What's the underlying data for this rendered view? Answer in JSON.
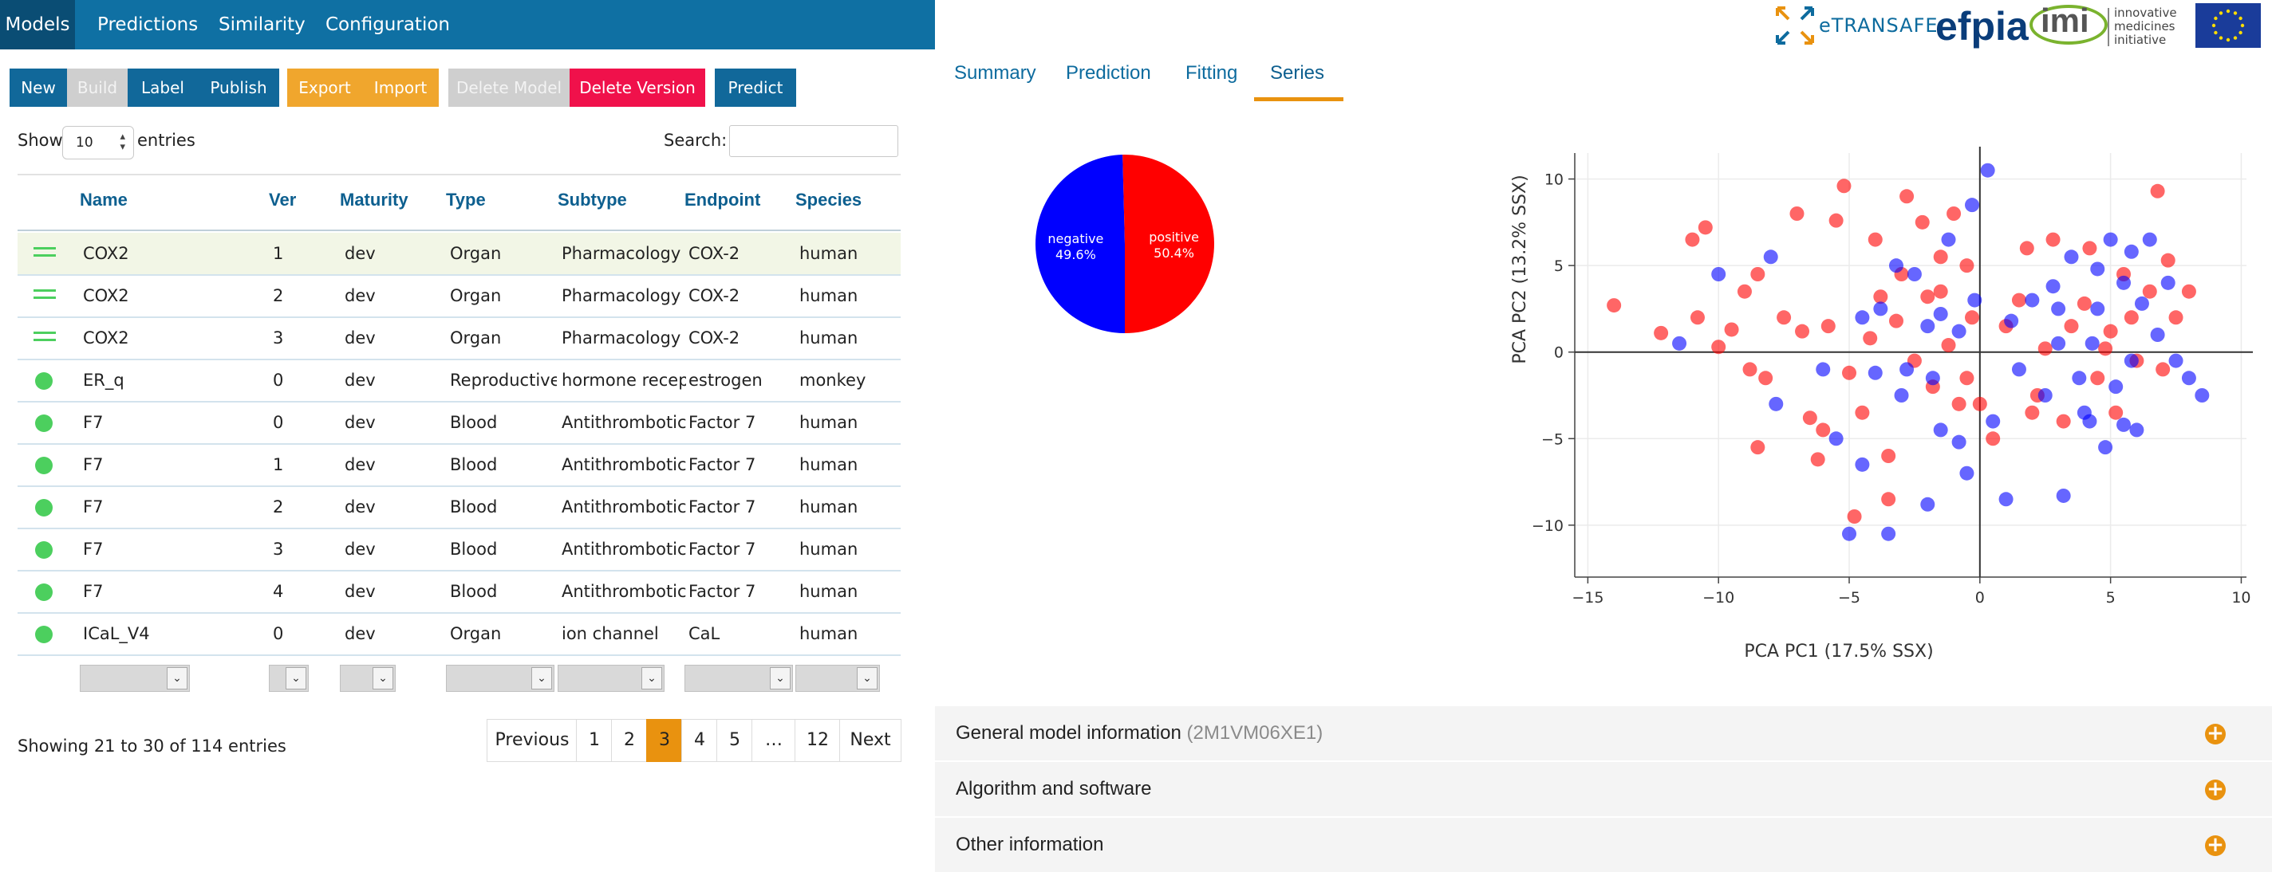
{
  "nav": {
    "tabs": [
      "Models",
      "Predictions",
      "Similarity",
      "Configuration"
    ],
    "active": "Models"
  },
  "toolbar": {
    "new": "New",
    "build": "Build",
    "label": "Label",
    "publish": "Publish",
    "export": "Export",
    "import": "Import",
    "delete_model": "Delete Model",
    "delete_version": "Delete Version",
    "predict": "Predict"
  },
  "table": {
    "show_label": "Show",
    "show_value": "10",
    "entries_label": "entries",
    "search_label": "Search:",
    "search_value": "",
    "columns": [
      "Name",
      "Ver",
      "Maturity",
      "Type",
      "Subtype",
      "Endpoint",
      "Species"
    ],
    "rows": [
      {
        "status": "draft",
        "name": "COX2",
        "ver": "1",
        "maturity": "dev",
        "type": "Organ",
        "subtype": "Pharmacology",
        "endpoint": "COX-2",
        "species": "human"
      },
      {
        "status": "draft",
        "name": "COX2",
        "ver": "2",
        "maturity": "dev",
        "type": "Organ",
        "subtype": "Pharmacology",
        "endpoint": "COX-2",
        "species": "human"
      },
      {
        "status": "draft",
        "name": "COX2",
        "ver": "3",
        "maturity": "dev",
        "type": "Organ",
        "subtype": "Pharmacology",
        "endpoint": "COX-2",
        "species": "human"
      },
      {
        "status": "published",
        "name": "ER_q",
        "ver": "0",
        "maturity": "dev",
        "type": "Reproductive",
        "subtype": "hormone recep",
        "endpoint": "estrogen",
        "species": "monkey"
      },
      {
        "status": "published",
        "name": "F7",
        "ver": "0",
        "maturity": "dev",
        "type": "Blood",
        "subtype": "Antithrombotic",
        "endpoint": "Factor 7",
        "species": "human"
      },
      {
        "status": "published",
        "name": "F7",
        "ver": "1",
        "maturity": "dev",
        "type": "Blood",
        "subtype": "Antithrombotic",
        "endpoint": "Factor 7",
        "species": "human"
      },
      {
        "status": "published",
        "name": "F7",
        "ver": "2",
        "maturity": "dev",
        "type": "Blood",
        "subtype": "Antithrombotic",
        "endpoint": "Factor 7",
        "species": "human"
      },
      {
        "status": "published",
        "name": "F7",
        "ver": "3",
        "maturity": "dev",
        "type": "Blood",
        "subtype": "Antithrombotic",
        "endpoint": "Factor 7",
        "species": "human"
      },
      {
        "status": "published",
        "name": "F7",
        "ver": "4",
        "maturity": "dev",
        "type": "Blood",
        "subtype": "Antithrombotic",
        "endpoint": "Factor 7",
        "species": "human"
      },
      {
        "status": "published",
        "name": "ICaL_V4",
        "ver": "0",
        "maturity": "dev",
        "type": "Organ",
        "subtype": "ion channel",
        "endpoint": "CaL",
        "species": "human"
      }
    ],
    "info": "Showing 21 to 30 of 114 entries",
    "pagination": {
      "prev": "Previous",
      "pages": [
        "1",
        "2",
        "3",
        "4",
        "5",
        "…",
        "12"
      ],
      "current": "3",
      "next": "Next"
    }
  },
  "detail": {
    "tabs": [
      "Summary",
      "Prediction",
      "Fitting",
      "Series"
    ],
    "active_tab": "Series",
    "accordion": [
      {
        "title": "General model information",
        "subtitle": "(2M1VM06XE1)"
      },
      {
        "title": "Algorithm and software",
        "subtitle": ""
      },
      {
        "title": "Other information",
        "subtitle": ""
      }
    ]
  },
  "logos": {
    "etransafe": "eTRANSAFE",
    "efpia": "efpia",
    "imi": "imi",
    "imi_text": [
      "innovative",
      "medicines",
      "initiative"
    ]
  },
  "colors": {
    "nav": "#0f70a3",
    "accent": "#e9920f",
    "positive": "#ff0000",
    "negative": "#0000ff",
    "status_green": "#4ccf5e"
  },
  "chart_data": [
    {
      "type": "pie",
      "slices": [
        {
          "label": "negative",
          "percent_label": "49.6%",
          "value": 49.6,
          "color": "#0000ff"
        },
        {
          "label": "positive",
          "percent_label": "50.4%",
          "value": 50.4,
          "color": "#ff0000"
        }
      ]
    },
    {
      "type": "scatter",
      "xlabel": "PCA PC1 (17.5% SSX)",
      "ylabel": "PCA PC2 (13.2% SSX)",
      "xlim": [
        -15.5,
        10.2
      ],
      "ylim": [
        -13,
        11.5
      ],
      "xticks": [
        -15,
        -10,
        -5,
        0,
        5,
        10
      ],
      "yticks": [
        -10,
        -5,
        0,
        5,
        10
      ],
      "grid": true,
      "series": [
        {
          "color": "#ff0000",
          "points": [
            [
              -14,
              2.7
            ],
            [
              -12.2,
              1.1
            ],
            [
              -11,
              6.5
            ],
            [
              -10.5,
              7.2
            ],
            [
              -10.8,
              2.0
            ],
            [
              -9.5,
              1.3
            ],
            [
              -10,
              0.3
            ],
            [
              -9,
              3.5
            ],
            [
              -8.5,
              4.5
            ],
            [
              -8.8,
              -1.0
            ],
            [
              -8.5,
              -5.5
            ],
            [
              -8.2,
              -1.5
            ],
            [
              -7.5,
              2.0
            ],
            [
              -7,
              8.0
            ],
            [
              -6.8,
              1.2
            ],
            [
              -6.5,
              -3.8
            ],
            [
              -6,
              -4.5
            ],
            [
              -5.8,
              1.5
            ],
            [
              -5.5,
              7.6
            ],
            [
              -5.2,
              9.6
            ],
            [
              -5,
              -1.2
            ],
            [
              -4.8,
              -9.5
            ],
            [
              -4.5,
              -3.5
            ],
            [
              -4.2,
              0.8
            ],
            [
              -4,
              6.5
            ],
            [
              -3.8,
              3.2
            ],
            [
              -3.5,
              -6.0
            ],
            [
              -3.2,
              1.8
            ],
            [
              -3,
              4.5
            ],
            [
              -2.8,
              9.0
            ],
            [
              -2.5,
              -0.5
            ],
            [
              -2.2,
              7.5
            ],
            [
              -2,
              3.2
            ],
            [
              -1.8,
              -2.0
            ],
            [
              -1.5,
              5.5
            ],
            [
              -1.2,
              0.4
            ],
            [
              -1,
              8.0
            ],
            [
              -0.8,
              -3.0
            ],
            [
              -0.5,
              5.0
            ],
            [
              -0.3,
              2.0
            ],
            [
              -0.5,
              -1.5
            ],
            [
              0.5,
              -5.0
            ],
            [
              1,
              1.5
            ],
            [
              1.5,
              3.0
            ],
            [
              1.8,
              6.0
            ],
            [
              2,
              -3.5
            ],
            [
              2.5,
              0.2
            ],
            [
              2.8,
              6.5
            ],
            [
              3.2,
              -4.0
            ],
            [
              3.5,
              1.5
            ],
            [
              4,
              2.8
            ],
            [
              4.2,
              6.0
            ],
            [
              4.5,
              -1.5
            ],
            [
              4.8,
              0.2
            ],
            [
              5,
              1.2
            ],
            [
              5.2,
              -3.5
            ],
            [
              5.5,
              4.5
            ],
            [
              5.8,
              2.0
            ],
            [
              6,
              -0.5
            ],
            [
              6.5,
              3.5
            ],
            [
              7,
              -1.0
            ],
            [
              7.2,
              5.3
            ],
            [
              7.5,
              2.0
            ],
            [
              8,
              3.5
            ],
            [
              6.8,
              9.3
            ],
            [
              -1.5,
              3.5
            ],
            [
              -3.5,
              -8.5
            ],
            [
              2.2,
              -2.5
            ],
            [
              0,
              -3.0
            ],
            [
              -6.2,
              -6.2
            ]
          ]
        },
        {
          "color": "#0000ff",
          "points": [
            [
              -11.5,
              0.5
            ],
            [
              -10,
              4.5
            ],
            [
              -8,
              5.5
            ],
            [
              -7.8,
              -3.0
            ],
            [
              -6,
              -1.0
            ],
            [
              -5.5,
              -5.0
            ],
            [
              -5,
              -10.5
            ],
            [
              -4.5,
              2.0
            ],
            [
              -4,
              -1.2
            ],
            [
              -3.5,
              -10.5
            ],
            [
              -3.2,
              5.0
            ],
            [
              -3,
              -2.5
            ],
            [
              -2.8,
              -1.0
            ],
            [
              -2.5,
              4.5
            ],
            [
              -2,
              -8.8
            ],
            [
              -1.8,
              -1.5
            ],
            [
              -1.5,
              2.2
            ],
            [
              -1.2,
              6.5
            ],
            [
              -0.8,
              1.2
            ],
            [
              -0.5,
              -7.0
            ],
            [
              -0.3,
              8.5
            ],
            [
              0.3,
              10.5
            ],
            [
              0.5,
              -4.0
            ],
            [
              1,
              -8.5
            ],
            [
              1.5,
              -1.0
            ],
            [
              2,
              3.0
            ],
            [
              2.5,
              -2.5
            ],
            [
              3,
              0.5
            ],
            [
              3.2,
              -8.3
            ],
            [
              3.5,
              5.5
            ],
            [
              3.8,
              -1.5
            ],
            [
              4,
              -3.5
            ],
            [
              4.3,
              0.5
            ],
            [
              4.5,
              2.5
            ],
            [
              4.8,
              -5.5
            ],
            [
              5,
              6.5
            ],
            [
              5.2,
              -2.0
            ],
            [
              5.5,
              4.0
            ],
            [
              5.8,
              -0.5
            ],
            [
              6,
              -4.5
            ],
            [
              6.2,
              2.8
            ],
            [
              6.5,
              6.5
            ],
            [
              6.8,
              1.0
            ],
            [
              7.2,
              4.0
            ],
            [
              7.5,
              -0.5
            ],
            [
              8,
              -1.5
            ],
            [
              8.5,
              -2.5
            ],
            [
              5.5,
              -4.2
            ],
            [
              4.2,
              -4.0
            ],
            [
              -2,
              1.5
            ],
            [
              -4.5,
              -6.5
            ],
            [
              -1.5,
              -4.5
            ],
            [
              3,
              2.5
            ],
            [
              1.2,
              1.8
            ],
            [
              -0.2,
              3.0
            ],
            [
              2.8,
              3.8
            ],
            [
              5.8,
              5.8
            ],
            [
              4.5,
              4.8
            ],
            [
              -3.8,
              2.5
            ],
            [
              -0.8,
              -5.2
            ]
          ]
        }
      ]
    }
  ]
}
